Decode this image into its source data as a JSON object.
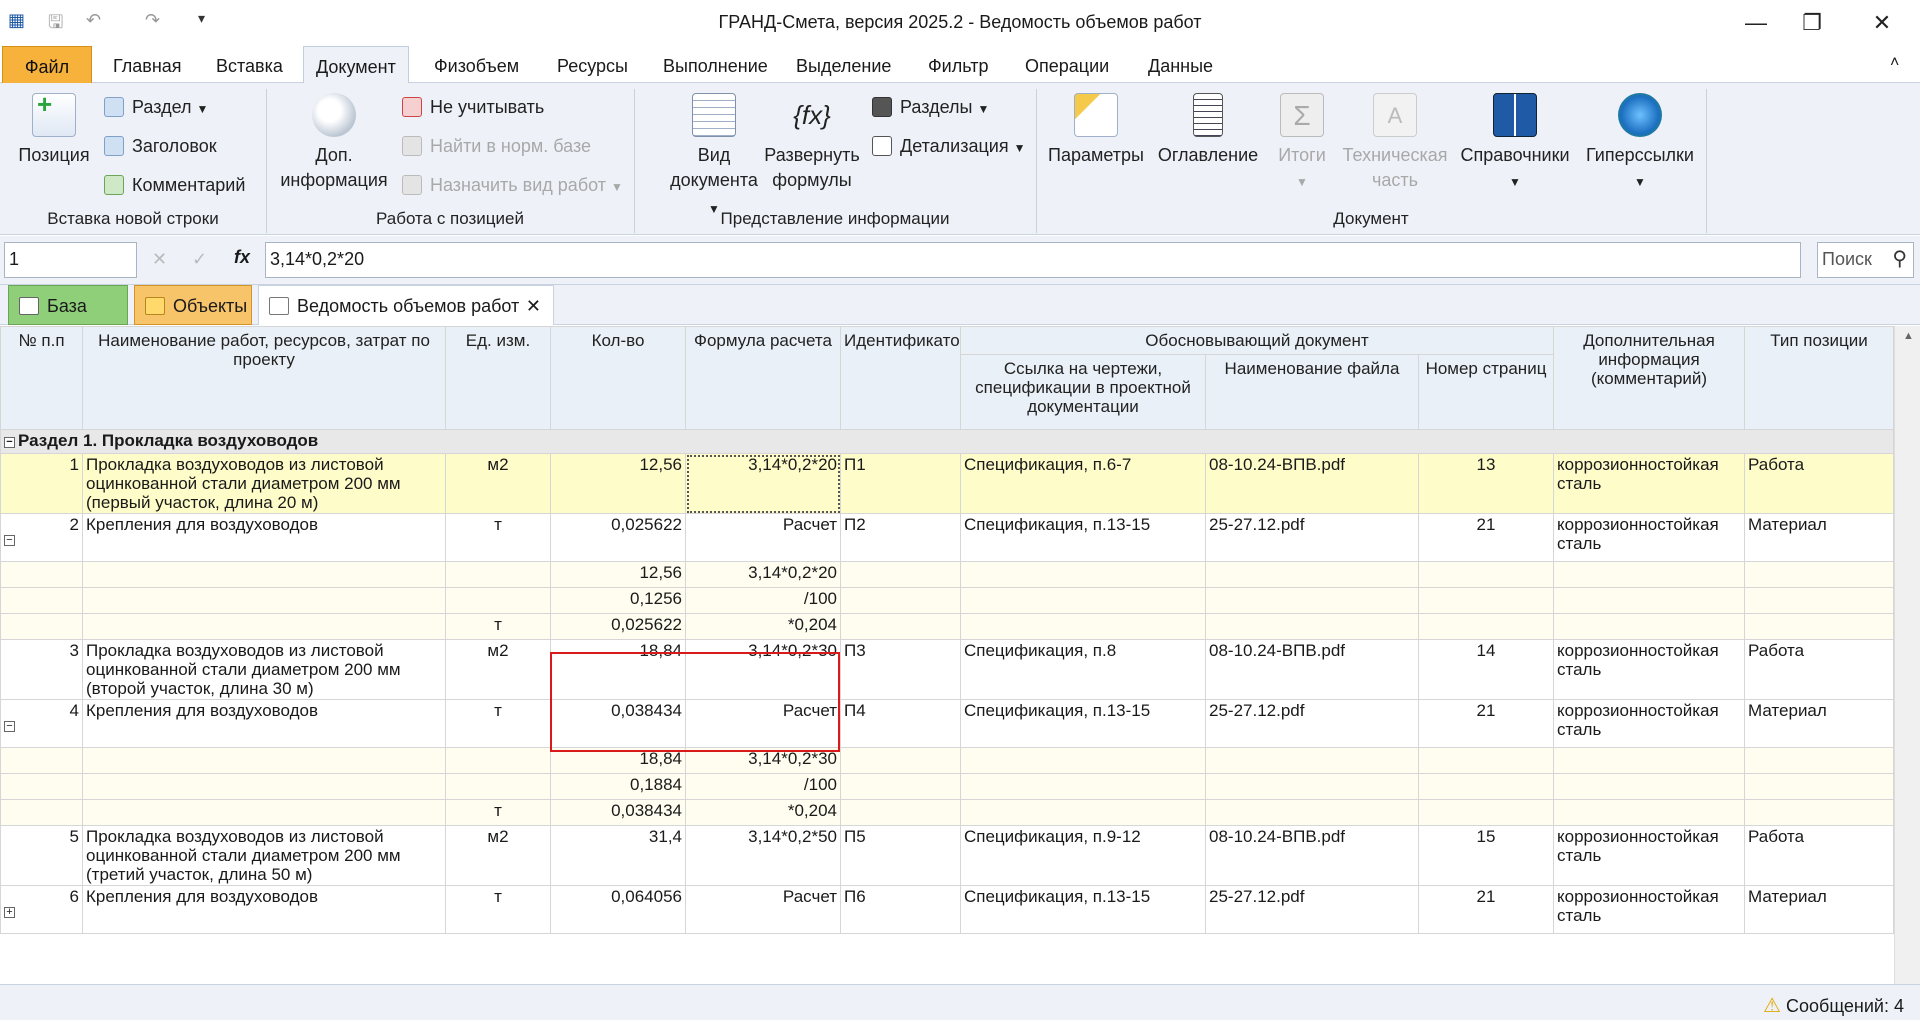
{
  "window": {
    "title": "ГРАНД-Смета, версия 2025.2 - Ведомость объемов работ"
  },
  "menu": [
    "Файл",
    "Главная",
    "Вставка",
    "Документ",
    "Физобъем",
    "Ресурсы",
    "Выполнение",
    "Выделение",
    "Фильтр",
    "Операции",
    "Данные"
  ],
  "ribbon": {
    "g1": {
      "label": "Вставка новой строки",
      "pos": "Позиция",
      "razdel": "Раздел",
      "zagolovok": "Заголовок",
      "komment": "Комментарий"
    },
    "g2": {
      "label": "Работа с позицией",
      "dop1": "Доп.",
      "dop2": "информация",
      "ne": "Не учитывать",
      "najti": "Найти в норм. базе",
      "naznach": "Назначить вид работ"
    },
    "g3": {
      "label": "Представление информации",
      "vid1": "Вид",
      "vid2": "документа",
      "razv1": "Развернуть",
      "razv2": "формулы",
      "razdely": "Разделы",
      "detal": "Детализация"
    },
    "g4": {
      "label": "Документ",
      "param": "Параметры",
      "oglav": "Оглавление",
      "itogi": "Итоги",
      "tech1": "Техническая",
      "tech2": "часть",
      "sprav": "Справочники",
      "giper": "Гиперссылки"
    }
  },
  "formula": {
    "cellref": "1",
    "fx": "fx",
    "value": "3,14*0,2*20",
    "search_placeholder": "Поиск"
  },
  "tabs": {
    "baza": "База",
    "obj": "Объекты",
    "ved": "Ведомость объемов работ"
  },
  "columns": {
    "num": "№ п.п",
    "name": "Наименование работ, ресурсов, затрат по проекту",
    "unit": "Ед. изм.",
    "qty": "Кол-во",
    "formula": "Формула расчета",
    "ident": "Идентификатор",
    "doc": "Обосновывающий документ",
    "ref": "Ссылка на чертежи, спецификации в проектной документации",
    "file": "Наименование файла",
    "pages": "Номер страниц",
    "extra": "Дополнительная информация (комментарий)",
    "type": "Тип позиции"
  },
  "section": "Раздел 1. Прокладка воздуховодов",
  "rows": [
    {
      "n": "1",
      "name": "Прокладка воздуховодов из листовой оцинкованной стали диаметром 200 мм (первый участок, длина 20 м)",
      "unit": "м2",
      "qty": "12,56",
      "f": "3,14*0,2*20",
      "id": "П1",
      "ref": "Спецификация, п.6-7",
      "file": "08-10.24-ВПВ.pdf",
      "pg": "13",
      "ex": "коррозионностойкая сталь",
      "t": "Работа"
    },
    {
      "n": "2",
      "name": "Крепления для воздуховодов",
      "unit": "т",
      "qty": "0,025622",
      "f": "Расчет",
      "id": "П2",
      "ref": "Спецификация, п.13-15",
      "file": "25-27.12.pdf",
      "pg": "21",
      "ex": "коррозионностойкая сталь",
      "t": "Материал"
    },
    {
      "qty": "12,56",
      "f": "3,14*0,2*20"
    },
    {
      "qty": "0,1256",
      "f": "/100"
    },
    {
      "unit": "т",
      "qty": "0,025622",
      "f": "*0,204"
    },
    {
      "n": "3",
      "name": "Прокладка воздуховодов из листовой оцинкованной стали диаметром 200 мм (второй участок, длина 30 м)",
      "unit": "м2",
      "qty": "18,84",
      "f": "3,14*0,2*30",
      "id": "П3",
      "ref": "Спецификация, п.8",
      "file": "08-10.24-ВПВ.pdf",
      "pg": "14",
      "ex": "коррозионностойкая сталь",
      "t": "Работа"
    },
    {
      "n": "4",
      "name": "Крепления для воздуховодов",
      "unit": "т",
      "qty": "0,038434",
      "f": "Расчет",
      "id": "П4",
      "ref": "Спецификация, п.13-15",
      "file": "25-27.12.pdf",
      "pg": "21",
      "ex": "коррозионностойкая сталь",
      "t": "Материал"
    },
    {
      "qty": "18,84",
      "f": "3,14*0,2*30"
    },
    {
      "qty": "0,1884",
      "f": "/100"
    },
    {
      "unit": "т",
      "qty": "0,038434",
      "f": "*0,204"
    },
    {
      "n": "5",
      "name": "Прокладка воздуховодов из листовой оцинкованной стали диаметром 200 мм (третий участок, длина 50 м)",
      "unit": "м2",
      "qty": "31,4",
      "f": "3,14*0,2*50",
      "id": "П5",
      "ref": "Спецификация, п.9-12",
      "file": "08-10.24-ВПВ.pdf",
      "pg": "15",
      "ex": "коррозионностойкая сталь",
      "t": "Работа"
    },
    {
      "n": "6",
      "name": "Крепления для воздуховодов",
      "unit": "т",
      "qty": "0,064056",
      "f": "Расчет",
      "id": "П6",
      "ref": "Спецификация, п.13-15",
      "file": "25-27.12.pdf",
      "pg": "21",
      "ex": "коррозионностойкая сталь",
      "t": "Материал"
    }
  ],
  "status": "Сообщений: 4"
}
